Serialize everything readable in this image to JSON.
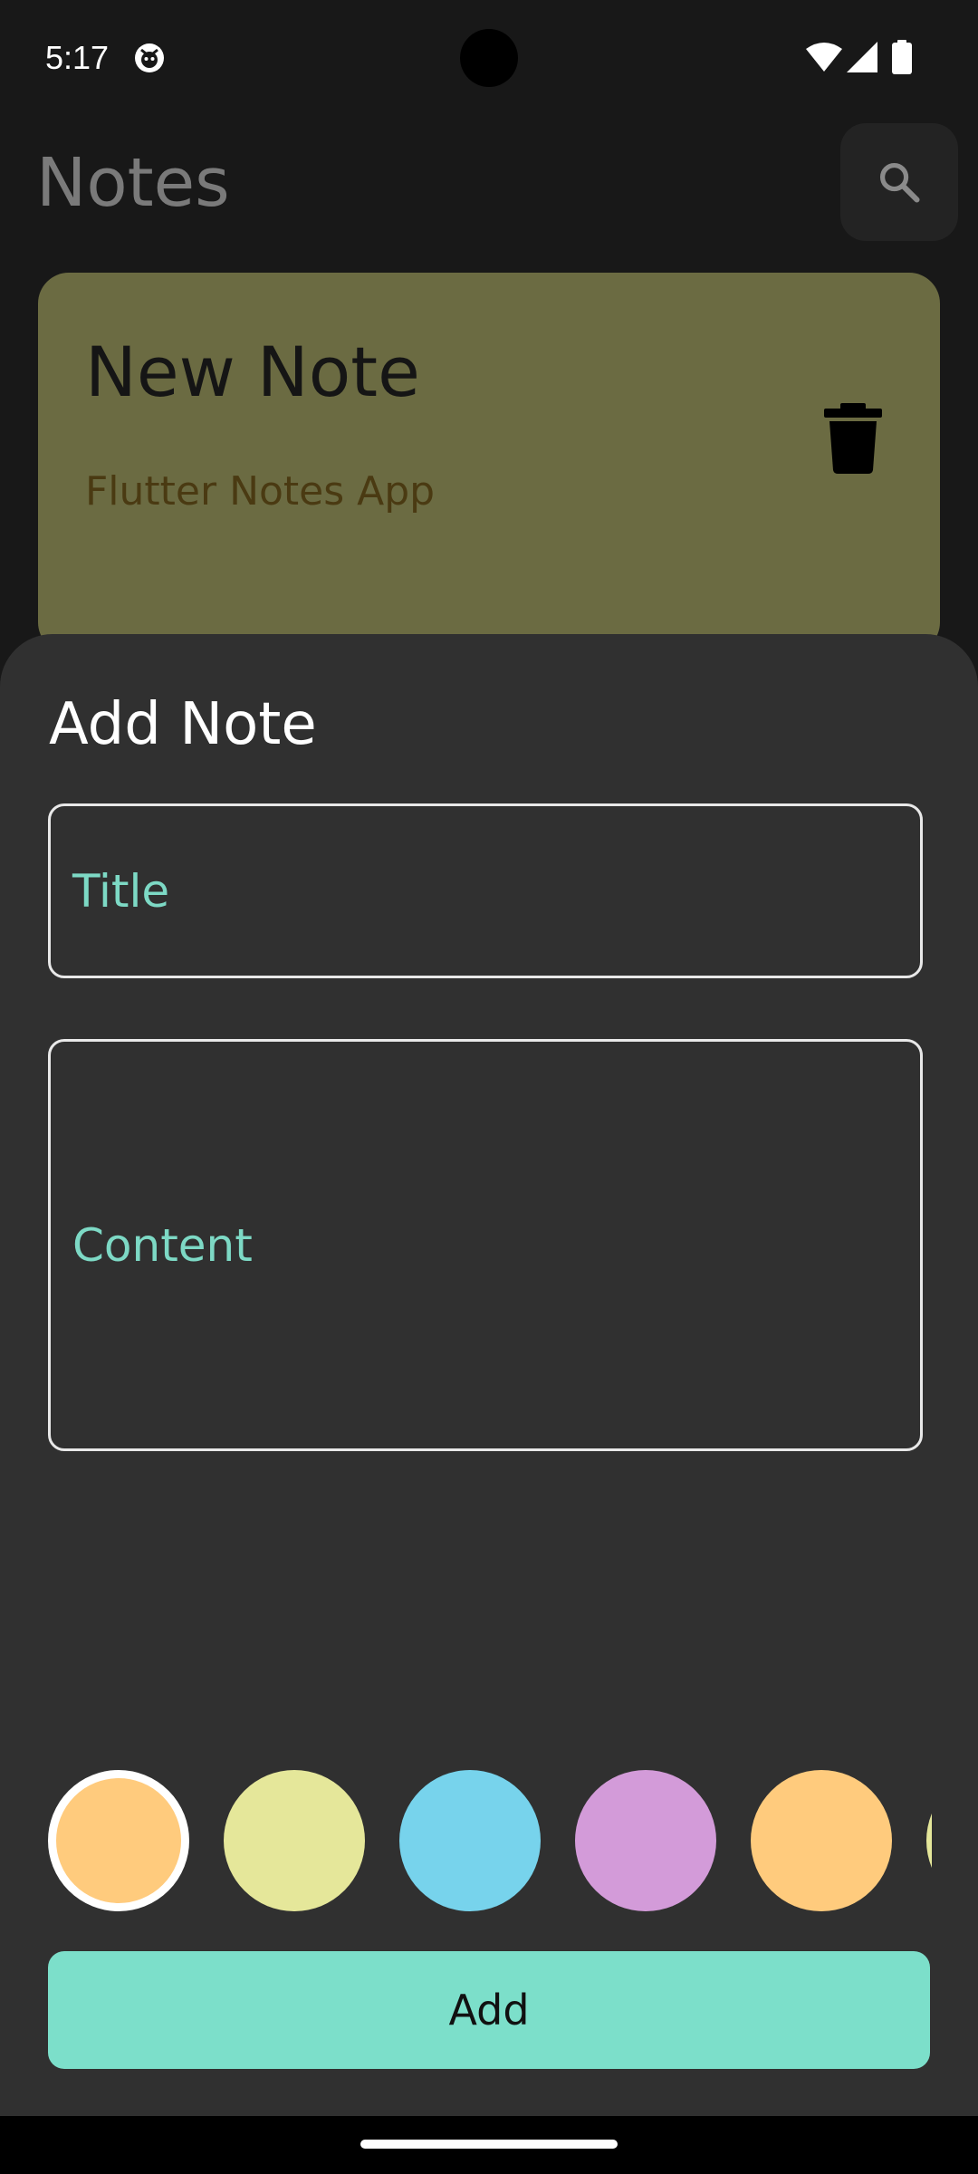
{
  "status_bar": {
    "time": "5:17",
    "icons": [
      "app-notification-icon",
      "wifi-icon",
      "signal-icon",
      "battery-icon"
    ]
  },
  "app_bar": {
    "title": "Notes",
    "search_icon": "search-icon"
  },
  "notes": [
    {
      "title": "New Note",
      "content": "Flutter Notes App",
      "color": "#6b6b42",
      "delete_icon": "trash-icon"
    }
  ],
  "sheet": {
    "title": "Add Note",
    "title_placeholder": "Title",
    "content_placeholder": "Content",
    "colors": [
      {
        "hex": "#ffcb7d",
        "selected": true
      },
      {
        "hex": "#e5e79a",
        "selected": false
      },
      {
        "hex": "#77d3ec",
        "selected": false
      },
      {
        "hex": "#d39bd9",
        "selected": false
      },
      {
        "hex": "#ffcb7d",
        "selected": false
      },
      {
        "hex": "#e5e79a",
        "selected": false
      }
    ],
    "add_label": "Add"
  },
  "theme": {
    "accent": "#7cdfca",
    "placeholder": "#7dd9c5",
    "sheet_background": "#303030",
    "app_background": "#181818"
  }
}
